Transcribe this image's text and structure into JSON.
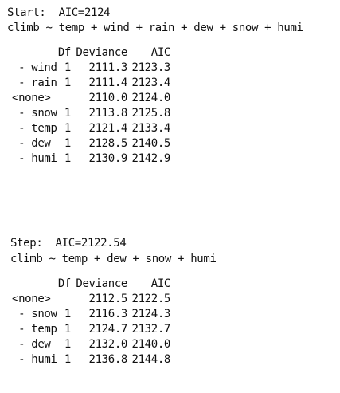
{
  "block1": {
    "header": "Start:  AIC=2124",
    "formula": "climb ~ temp + wind + rain + dew + snow + humi",
    "columns": {
      "df": "Df",
      "deviance": "Deviance",
      "aic": "AIC"
    },
    "rows": [
      {
        "term": " - wind",
        "df": "1",
        "deviance": "2111.3",
        "aic": "2123.3"
      },
      {
        "term": " - rain",
        "df": "1",
        "deviance": "2111.4",
        "aic": "2123.4"
      },
      {
        "term": "<none>",
        "df": "",
        "deviance": "2110.0",
        "aic": "2124.0"
      },
      {
        "term": " - snow",
        "df": "1",
        "deviance": "2113.8",
        "aic": "2125.8"
      },
      {
        "term": " - temp",
        "df": "1",
        "deviance": "2121.4",
        "aic": "2133.4"
      },
      {
        "term": " - dew",
        "df": "1",
        "deviance": "2128.5",
        "aic": "2140.5"
      },
      {
        "term": " - humi",
        "df": "1",
        "deviance": "2130.9",
        "aic": "2142.9"
      }
    ]
  },
  "block2": {
    "header": "Step:  AIC=2122.54",
    "formula": "climb ~ temp + dew + snow + humi",
    "columns": {
      "df": "Df",
      "deviance": "Deviance",
      "aic": "AIC"
    },
    "rows": [
      {
        "term": "<none>",
        "df": "",
        "deviance": "2112.5",
        "aic": "2122.5"
      },
      {
        "term": " - snow",
        "df": "1",
        "deviance": "2116.3",
        "aic": "2124.3"
      },
      {
        "term": " - temp",
        "df": "1",
        "deviance": "2124.7",
        "aic": "2132.7"
      },
      {
        "term": " - dew",
        "df": "1",
        "deviance": "2132.0",
        "aic": "2140.0"
      },
      {
        "term": " - humi",
        "df": "1",
        "deviance": "2136.8",
        "aic": "2144.8"
      }
    ]
  }
}
